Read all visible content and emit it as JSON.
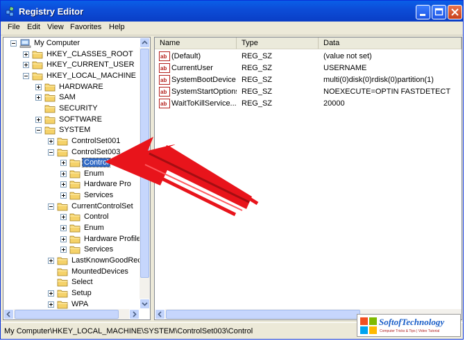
{
  "window": {
    "title": "Registry Editor",
    "buttons": [
      "minimize-icon",
      "maximize-icon",
      "close-icon"
    ]
  },
  "menu": [
    "File",
    "Edit",
    "View",
    "Favorites",
    "Help"
  ],
  "tree": [
    {
      "label": "My Computer",
      "level": 0,
      "expander": "minus",
      "icon": "computer-icon"
    },
    {
      "label": "HKEY_CLASSES_ROOT",
      "level": 1,
      "expander": "plus"
    },
    {
      "label": "HKEY_CURRENT_USER",
      "level": 1,
      "expander": "plus"
    },
    {
      "label": "HKEY_LOCAL_MACHINE",
      "level": 1,
      "expander": "minus"
    },
    {
      "label": "HARDWARE",
      "level": 2,
      "expander": "plus"
    },
    {
      "label": "SAM",
      "level": 2,
      "expander": "plus"
    },
    {
      "label": "SECURITY",
      "level": 2,
      "expander": "none"
    },
    {
      "label": "SOFTWARE",
      "level": 2,
      "expander": "plus"
    },
    {
      "label": "SYSTEM",
      "level": 2,
      "expander": "minus"
    },
    {
      "label": "ControlSet001",
      "level": 3,
      "expander": "plus"
    },
    {
      "label": "ControlSet003",
      "level": 3,
      "expander": "minus"
    },
    {
      "label": "Control",
      "level": 4,
      "expander": "plus",
      "selected": true
    },
    {
      "label": "Enum",
      "level": 4,
      "expander": "plus"
    },
    {
      "label": "Hardware Pro",
      "level": 4,
      "expander": "plus"
    },
    {
      "label": "Services",
      "level": 4,
      "expander": "plus"
    },
    {
      "label": "CurrentControlSet",
      "level": 3,
      "expander": "minus"
    },
    {
      "label": "Control",
      "level": 4,
      "expander": "plus"
    },
    {
      "label": "Enum",
      "level": 4,
      "expander": "plus"
    },
    {
      "label": "Hardware Profile",
      "level": 4,
      "expander": "plus"
    },
    {
      "label": "Services",
      "level": 4,
      "expander": "plus"
    },
    {
      "label": "LastKnownGoodRec",
      "level": 3,
      "expander": "plus"
    },
    {
      "label": "MountedDevices",
      "level": 3,
      "expander": "none"
    },
    {
      "label": "Select",
      "level": 3,
      "expander": "none"
    },
    {
      "label": "Setup",
      "level": 3,
      "expander": "plus"
    },
    {
      "label": "WPA",
      "level": 3,
      "expander": "plus"
    }
  ],
  "list": {
    "columns": [
      "Name",
      "Type",
      "Data"
    ],
    "rows": [
      {
        "name": "(Default)",
        "type": "REG_SZ",
        "data": "(value not set)"
      },
      {
        "name": "CurrentUser",
        "type": "REG_SZ",
        "data": "USERNAME"
      },
      {
        "name": "SystemBootDevice",
        "type": "REG_SZ",
        "data": "multi(0)disk(0)rdisk(0)partition(1)"
      },
      {
        "name": "SystemStartOptions",
        "type": "REG_SZ",
        "data": "NOEXECUTE=OPTIN  FASTDETECT"
      },
      {
        "name": "WaitToKillService...",
        "type": "REG_SZ",
        "data": "20000"
      }
    ]
  },
  "status": "My Computer\\HKEY_LOCAL_MACHINE\\SYSTEM\\ControlSet003\\Control",
  "logo": {
    "title": "SoftofTechnology",
    "tagline": "Computer Tricks & Tips | Video Tutorial"
  },
  "colors": {
    "titlebar": "#0a4fdc",
    "selection": "#316ac5",
    "arrow": "#e8141b",
    "folder": "#f5d26a"
  }
}
